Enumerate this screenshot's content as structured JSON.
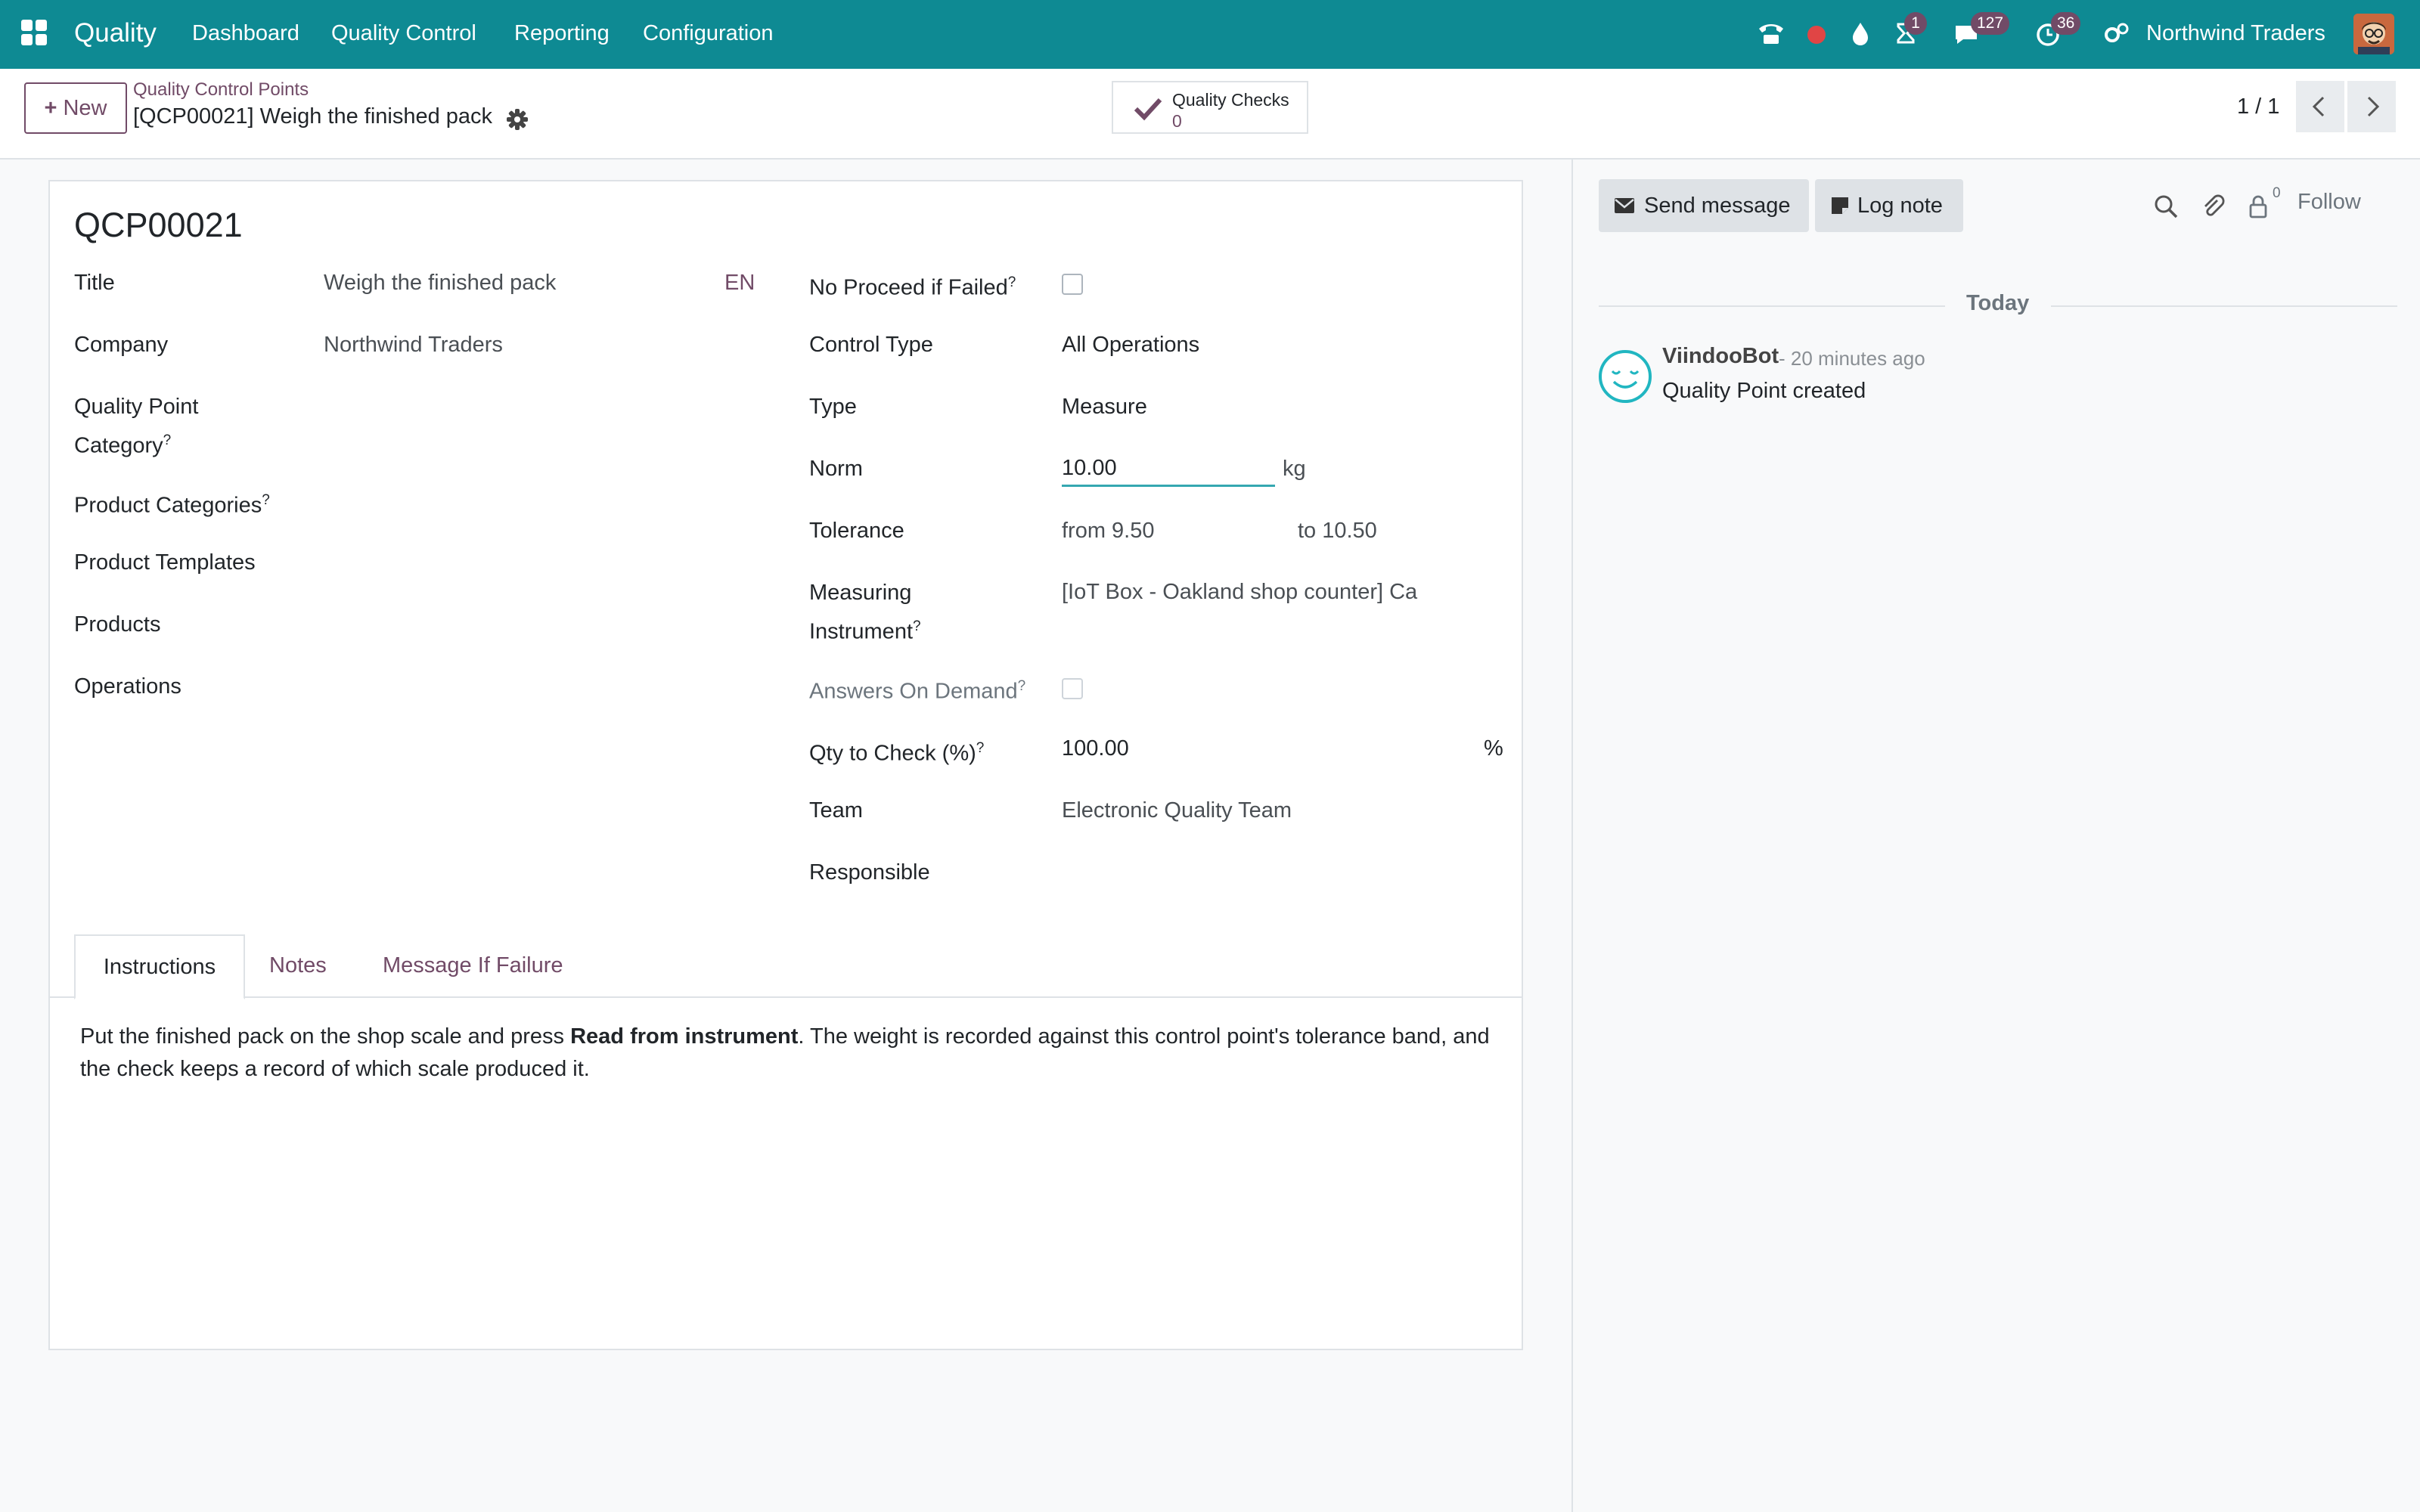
{
  "navbar": {
    "app_name": "Quality",
    "menu": [
      "Dashboard",
      "Quality Control",
      "Reporting",
      "Configuration"
    ],
    "badges": {
      "activity": "1",
      "messages": "127",
      "timesheet": "36"
    },
    "company": "Northwind Traders",
    "icons": [
      "apps-grid-icon",
      "phone-icon",
      "recording-dot-icon",
      "drop-icon",
      "hourglass-icon",
      "chat-icon",
      "clock-icon",
      "settings-icon"
    ],
    "accent_color": "#0e8a93"
  },
  "control_panel": {
    "new_label": "New",
    "breadcrumb_parent": "Quality Control Points",
    "breadcrumb_current": "[QCP00021] Weigh the finished pack",
    "smart_button": {
      "label": "Quality Checks",
      "value": "0"
    },
    "pager": "1 / 1"
  },
  "form": {
    "reference": "QCP00021",
    "left_fields": {
      "title_label": "Title",
      "title_value": "Weigh the finished pack",
      "lang": "EN",
      "company_label": "Company",
      "company_value": "Northwind Traders",
      "category_label_1": "Quality Point",
      "category_label_2": "Category",
      "product_categories_label": "Product Categories",
      "product_templates_label": "Product Templates",
      "products_label": "Products",
      "operations_label": "Operations"
    },
    "right_fields": {
      "no_proceed_label": "No Proceed if Failed",
      "control_type_label": "Control Type",
      "control_type_value": "All Operations",
      "type_label": "Type",
      "type_value": "Measure",
      "norm_label": "Norm",
      "norm_value": "10.00",
      "norm_unit": "kg",
      "tolerance_label": "Tolerance",
      "tolerance_from": "from 9.50",
      "tolerance_to": "to 10.50",
      "instrument_label_1": "Measuring",
      "instrument_label_2": "Instrument",
      "instrument_value": "[IoT Box - Oakland shop counter] Ca",
      "answers_label": "Answers On Demand",
      "qty_label": "Qty to Check (%)",
      "qty_value": "100.00",
      "qty_unit": "%",
      "team_label": "Team",
      "team_value": "Electronic Quality Team",
      "responsible_label": "Responsible"
    },
    "help_mark": "?",
    "tabs": [
      "Instructions",
      "Notes",
      "Message If Failure"
    ],
    "instructions": {
      "part1": "Put the finished pack on the shop scale and press ",
      "bold": "Read from instrument",
      "part2": ". The weight is recorded against this control point's tolerance band, and the check keeps a record of which scale produced it."
    }
  },
  "chatter": {
    "send_message": "Send message",
    "log_note": "Log note",
    "follower_count": "0",
    "follow": "Follow",
    "date_separator": "Today",
    "message": {
      "author": "ViindooBot",
      "time": "- 20 minutes ago",
      "body": "Quality Point created"
    }
  }
}
